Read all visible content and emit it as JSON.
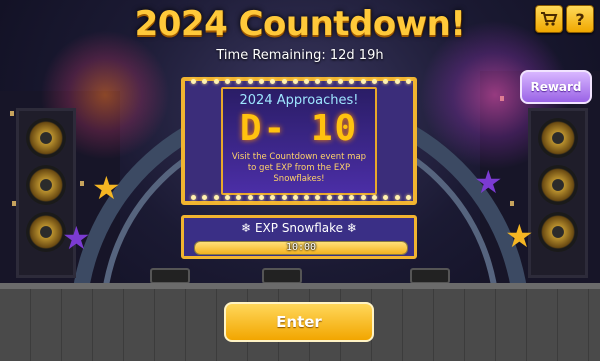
{
  "header": {
    "title": "2024 Countdown!",
    "time_remaining": "Time Remaining: 12d 19h",
    "shop_icon": "cart-icon",
    "help_label": "?"
  },
  "reward_button": {
    "label": "Reward"
  },
  "board": {
    "heading": "2024 Approaches!",
    "dday": "D- 10",
    "description": "Visit the Countdown event map to get EXP from the EXP Snowflakes!"
  },
  "snowflake": {
    "title": "❄ EXP Snowflake ❄",
    "timer": "10:00",
    "progress": 1.0
  },
  "enter_button": {
    "label": "Enter"
  },
  "colors": {
    "accent": "#ffc93a",
    "panel": "#3b2d7a",
    "reward": "#9a63e6"
  }
}
